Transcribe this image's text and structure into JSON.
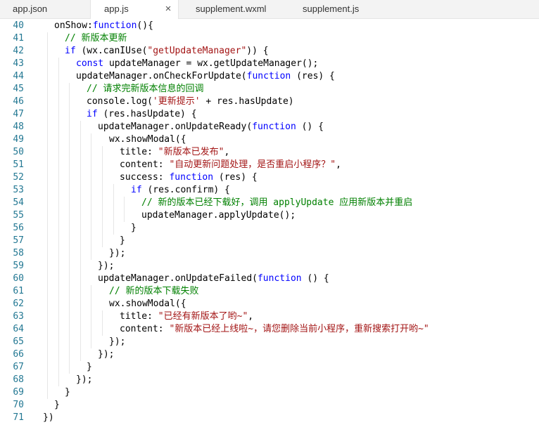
{
  "tabs": [
    {
      "label": "app.json"
    },
    {
      "label": "app.js",
      "active": true,
      "close": "×"
    },
    {
      "label": "supplement.wxml"
    },
    {
      "label": "supplement.js"
    }
  ],
  "editor": {
    "lines": [
      {
        "n": "40",
        "indent": 1,
        "tokens": [
          [
            "t",
            "onShow:"
          ],
          [
            "k",
            "function"
          ],
          [
            "t",
            "(){"
          ]
        ]
      },
      {
        "n": "41",
        "indent": 2,
        "tokens": [
          [
            "c",
            "// 新版本更新"
          ]
        ]
      },
      {
        "n": "42",
        "indent": 2,
        "tokens": [
          [
            "k",
            "if"
          ],
          [
            "t",
            " (wx.canIUse("
          ],
          [
            "s",
            "\"getUpdateManager\""
          ],
          [
            "t",
            ")) {"
          ]
        ]
      },
      {
        "n": "43",
        "indent": 3,
        "tokens": [
          [
            "k",
            "const"
          ],
          [
            "t",
            " updateManager = wx.getUpdateManager();"
          ]
        ]
      },
      {
        "n": "44",
        "indent": 3,
        "tokens": [
          [
            "t",
            "updateManager.onCheckForUpdate("
          ],
          [
            "k",
            "function"
          ],
          [
            "t",
            " (res) {"
          ]
        ]
      },
      {
        "n": "45",
        "indent": 4,
        "tokens": [
          [
            "c",
            "// 请求完新版本信息的回调"
          ]
        ]
      },
      {
        "n": "46",
        "indent": 4,
        "tokens": [
          [
            "t",
            "console.log("
          ],
          [
            "s",
            "'更新提示'"
          ],
          [
            "t",
            " + res.hasUpdate)"
          ]
        ]
      },
      {
        "n": "47",
        "indent": 4,
        "tokens": [
          [
            "k",
            "if"
          ],
          [
            "t",
            " (res.hasUpdate) {"
          ]
        ]
      },
      {
        "n": "48",
        "indent": 5,
        "tokens": [
          [
            "t",
            "updateManager.onUpdateReady("
          ],
          [
            "k",
            "function"
          ],
          [
            "t",
            " () {"
          ]
        ]
      },
      {
        "n": "49",
        "indent": 6,
        "tokens": [
          [
            "t",
            "wx.showModal({"
          ]
        ]
      },
      {
        "n": "50",
        "indent": 7,
        "tokens": [
          [
            "t",
            "title: "
          ],
          [
            "s",
            "\"新版本已发布\""
          ],
          [
            "t",
            ","
          ]
        ]
      },
      {
        "n": "51",
        "indent": 7,
        "tokens": [
          [
            "t",
            "content: "
          ],
          [
            "s",
            "\"自动更新问题处理，是否重启小程序？\""
          ],
          [
            "t",
            ","
          ]
        ]
      },
      {
        "n": "52",
        "indent": 7,
        "tokens": [
          [
            "t",
            "success: "
          ],
          [
            "k",
            "function"
          ],
          [
            "t",
            " (res) {"
          ]
        ]
      },
      {
        "n": "53",
        "indent": 8,
        "tokens": [
          [
            "k",
            "if"
          ],
          [
            "t",
            " (res.confirm) {"
          ]
        ]
      },
      {
        "n": "54",
        "indent": 9,
        "tokens": [
          [
            "c",
            "// 新的版本已经下载好，调用 applyUpdate 应用新版本并重启"
          ]
        ]
      },
      {
        "n": "55",
        "indent": 9,
        "tokens": [
          [
            "t",
            "updateManager.applyUpdate();"
          ]
        ]
      },
      {
        "n": "56",
        "indent": 8,
        "tokens": [
          [
            "t",
            "}"
          ]
        ]
      },
      {
        "n": "57",
        "indent": 7,
        "tokens": [
          [
            "t",
            "}"
          ]
        ]
      },
      {
        "n": "58",
        "indent": 6,
        "tokens": [
          [
            "t",
            "});"
          ]
        ]
      },
      {
        "n": "59",
        "indent": 5,
        "tokens": [
          [
            "t",
            "});"
          ]
        ]
      },
      {
        "n": "60",
        "indent": 5,
        "tokens": [
          [
            "t",
            "updateManager.onUpdateFailed("
          ],
          [
            "k",
            "function"
          ],
          [
            "t",
            " () {"
          ]
        ]
      },
      {
        "n": "61",
        "indent": 6,
        "tokens": [
          [
            "c",
            "// 新的版本下载失败"
          ]
        ]
      },
      {
        "n": "62",
        "indent": 6,
        "tokens": [
          [
            "t",
            "wx.showModal({"
          ]
        ]
      },
      {
        "n": "63",
        "indent": 7,
        "tokens": [
          [
            "t",
            "title: "
          ],
          [
            "s",
            "\"已经有新版本了哟~\""
          ],
          [
            "t",
            ","
          ]
        ]
      },
      {
        "n": "64",
        "indent": 7,
        "tokens": [
          [
            "t",
            "content: "
          ],
          [
            "s",
            "\"新版本已经上线啦~，请您删除当前小程序，重新搜索打开哟~\""
          ]
        ]
      },
      {
        "n": "65",
        "indent": 6,
        "tokens": [
          [
            "t",
            "});"
          ]
        ]
      },
      {
        "n": "66",
        "indent": 5,
        "tokens": [
          [
            "t",
            "});"
          ]
        ]
      },
      {
        "n": "67",
        "indent": 4,
        "tokens": [
          [
            "t",
            "}"
          ]
        ]
      },
      {
        "n": "68",
        "indent": 3,
        "tokens": [
          [
            "t",
            "});"
          ]
        ]
      },
      {
        "n": "69",
        "indent": 2,
        "tokens": [
          [
            "t",
            "}"
          ]
        ]
      },
      {
        "n": "70",
        "indent": 1,
        "tokens": [
          [
            "t",
            "}"
          ]
        ]
      },
      {
        "n": "71",
        "indent": 0,
        "tokens": [
          [
            "t",
            "})"
          ]
        ]
      }
    ]
  },
  "colors": {
    "keyword": "#0000ff",
    "string": "#a31515",
    "comment": "#008000",
    "line_number": "#237893",
    "tab_bar": "#f3f3f3"
  }
}
